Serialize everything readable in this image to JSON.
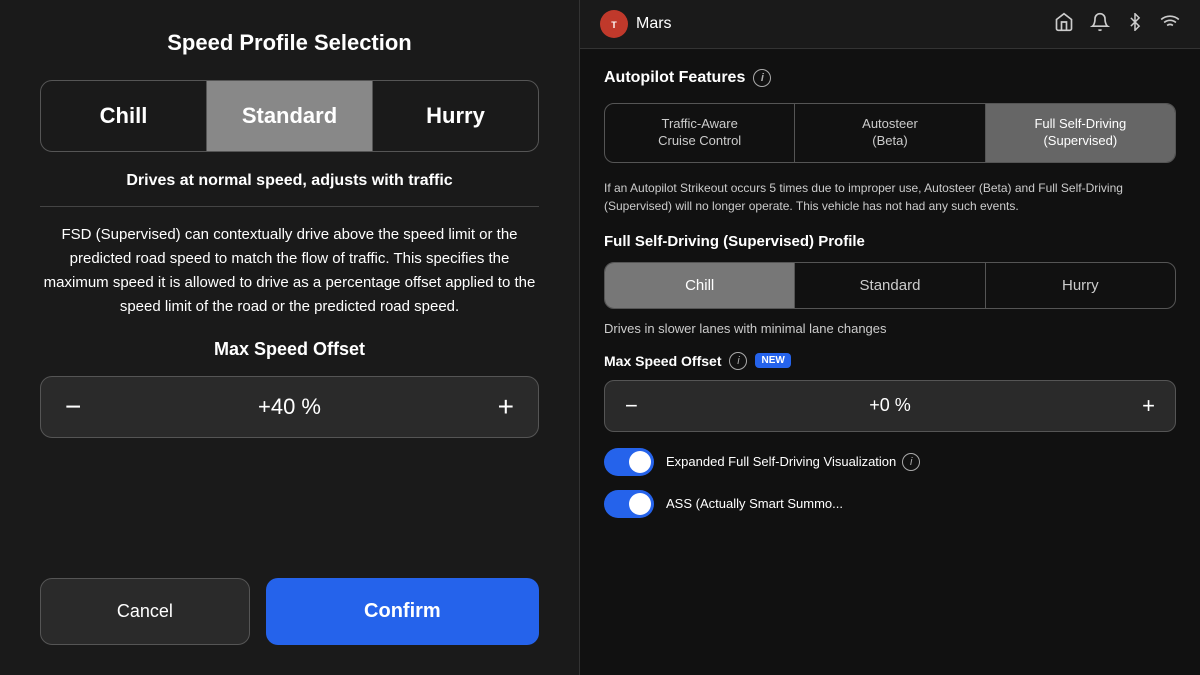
{
  "left": {
    "title": "Speed Profile Selection",
    "tabs": [
      {
        "id": "chill",
        "label": "Chill",
        "active": false
      },
      {
        "id": "standard",
        "label": "Standard",
        "active": true
      },
      {
        "id": "hurry",
        "label": "Hurry",
        "active": false
      }
    ],
    "tab_description": "Drives at normal speed, adjusts with traffic",
    "fsd_description": "FSD (Supervised) can contextually drive above the speed limit or the predicted road speed to match the flow of traffic. This specifies the maximum speed it is allowed to drive as a percentage offset applied to the speed limit of the road or the predicted road speed.",
    "max_speed_label": "Max Speed Offset",
    "offset_value": "+40 %",
    "decrement_label": "−",
    "increment_label": "+",
    "cancel_label": "Cancel",
    "confirm_label": "Confirm"
  },
  "right": {
    "header": {
      "brand_name": "Mars",
      "icons": [
        "🏠",
        "🔔",
        "✱",
        "📶"
      ]
    },
    "autopilot_section": "Autopilot Features",
    "feature_tabs": [
      {
        "label": "Traffic-Aware\nCruise Control",
        "active": false
      },
      {
        "label": "Autosteer\n(Beta)",
        "active": false
      },
      {
        "label": "Full Self-Driving\n(Supervised)",
        "active": true
      }
    ],
    "warning_text": "If an Autopilot Strikeout occurs 5 times due to improper use, Autosteer (Beta) and Full Self-Driving (Supervised) will no longer operate. This vehicle has not had any such events.",
    "fsd_profile_label": "Full Self-Driving (Supervised) Profile",
    "fsd_tabs": [
      {
        "label": "Chill",
        "active": true
      },
      {
        "label": "Standard",
        "active": false
      },
      {
        "label": "Hurry",
        "active": false
      }
    ],
    "fsd_tab_description": "Drives in slower lanes with minimal lane changes",
    "max_speed_row_label": "Max Speed Offset",
    "new_badge": "NEW",
    "offset_value": "+0 %",
    "decrement_label": "−",
    "increment_label": "+",
    "toggle1_label": "Expanded Full Self-Driving Visualization",
    "toggle2_label": "ASS (Actually Smart Summo..."
  }
}
